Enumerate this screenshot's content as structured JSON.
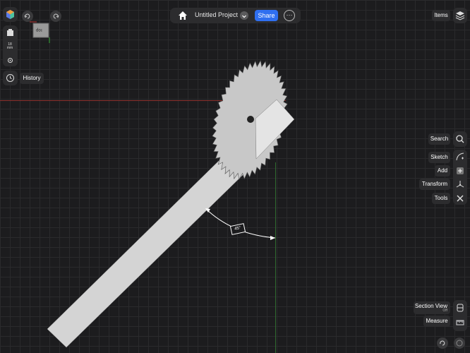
{
  "topbar": {
    "title": "Untitled Project",
    "share_label": "Share",
    "more_label": "⋯"
  },
  "left": {
    "unit_label": "18\nmm",
    "history_label": "History",
    "viewcube_face": "Top"
  },
  "right": {
    "items_label": "Items",
    "search_label": "Search",
    "sketch_label": "Sketch",
    "add_label": "Add",
    "transform_label": "Transform",
    "tools_label": "Tools",
    "section_view_label": "Section View",
    "section_view_state": "Off",
    "measure_label": "Measure"
  },
  "canvas": {
    "angle_label": "45°"
  },
  "colors": {
    "accent": "#2f6ff0",
    "x_axis": "#8a2f2a",
    "y_axis": "#2f6a2f",
    "panel": "#2c2c2e",
    "model": "#d4d4d4"
  }
}
